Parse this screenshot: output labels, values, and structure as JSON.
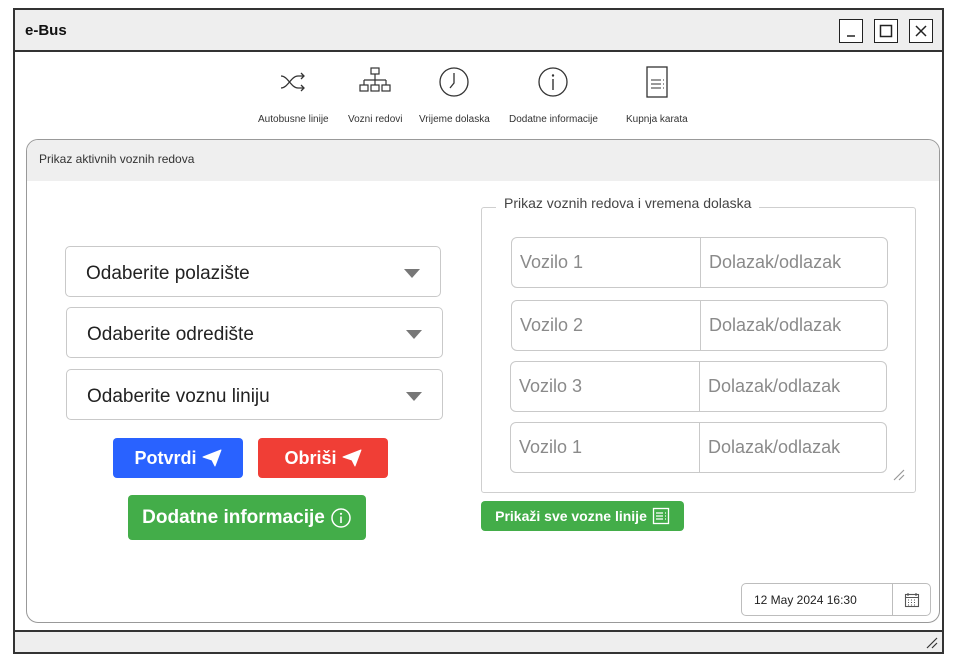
{
  "window": {
    "title": "e-Bus",
    "controls": [
      "minimize-icon",
      "maximize-icon",
      "close-icon"
    ]
  },
  "toolbar": {
    "items": [
      {
        "label": "Autobusne linije",
        "icon": "shuffle-icon"
      },
      {
        "label": "Vozni redovi",
        "icon": "sitemap-icon"
      },
      {
        "label": "Vrijeme dolaska",
        "icon": "clock-icon"
      },
      {
        "label": "Dodatne informacije",
        "icon": "info-icon"
      },
      {
        "label": "Kupnja karata",
        "icon": "document-icon"
      }
    ]
  },
  "panel": {
    "title": "Prikaz aktivnih voznih redova",
    "selects": [
      {
        "value": "Odaberite polazište"
      },
      {
        "value": "Odaberite odredište"
      },
      {
        "value": "Odaberite voznu liniju"
      }
    ],
    "buttons": {
      "confirm": "Potvrdi",
      "delete": "Obriši",
      "more_info": "Dodatne informacije",
      "show_all": "Prikaži sve vozne linije"
    },
    "timetable": {
      "legend": "Prikaz voznih redova i vremena dolaska",
      "rows": [
        {
          "vehicle": "Vozilo 1",
          "time": "Dolazak/odlazak"
        },
        {
          "vehicle": "Vozilo 2",
          "time": "Dolazak/odlazak"
        },
        {
          "vehicle": "Vozilo 3",
          "time": "Dolazak/odlazak"
        },
        {
          "vehicle": "Vozilo 1",
          "time": "Dolazak/odlazak"
        }
      ]
    },
    "datetime": "12 May 2024 16:30"
  },
  "colors": {
    "confirm": "#2962ff",
    "delete": "#f03e36",
    "success": "#43ad49"
  }
}
